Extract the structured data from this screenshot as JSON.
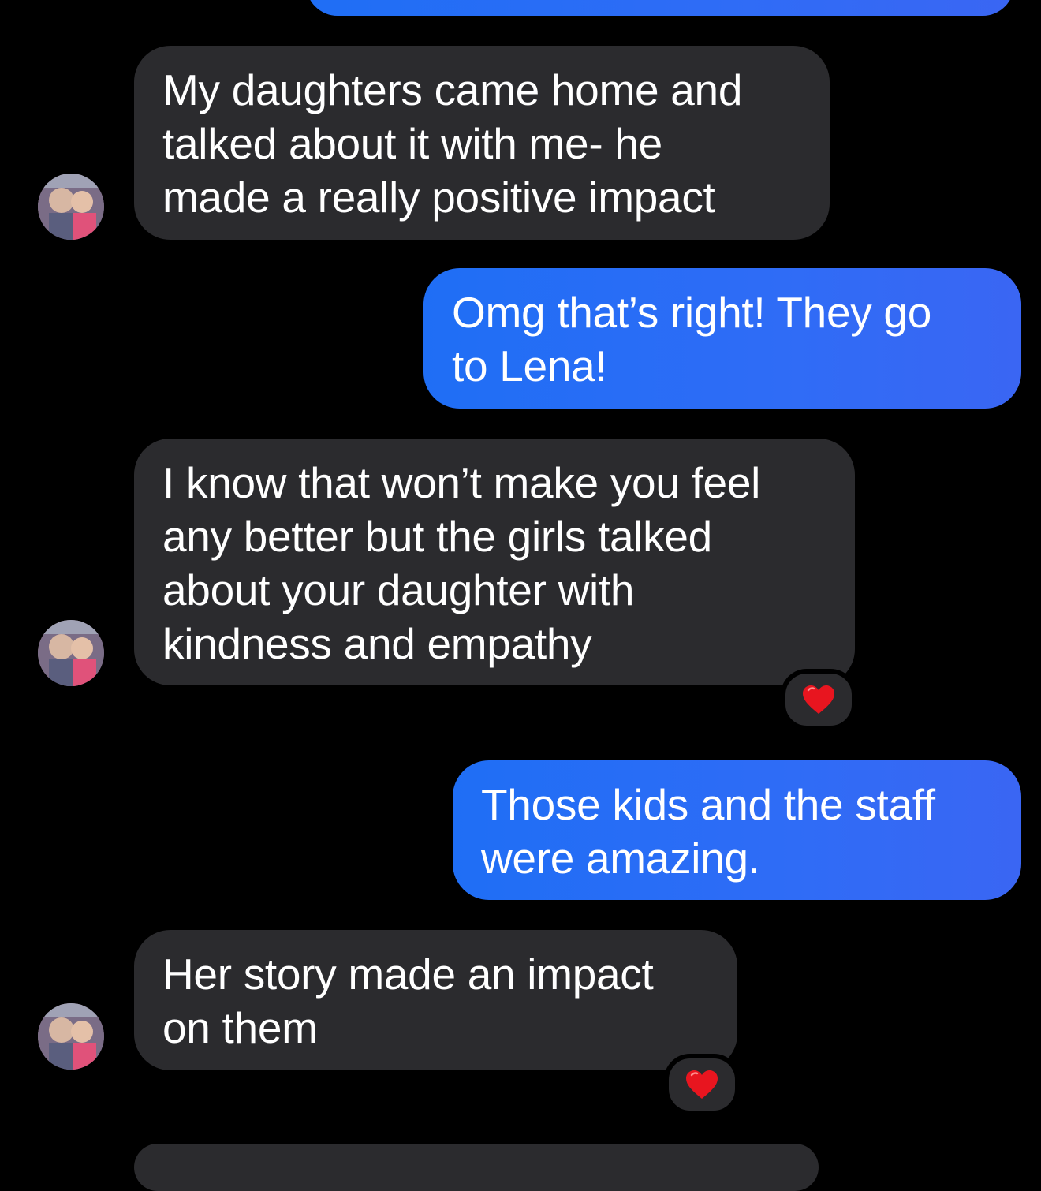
{
  "colors": {
    "background": "#000000",
    "incoming_bubble": "#2b2b2e",
    "outgoing_bubble": "#2f6cf6",
    "text": "#ffffff",
    "heart": "#e8151f"
  },
  "messages": [
    {
      "direction": "incoming",
      "text": "My daughters came home and\ntalked about it with me- he\nmade a really positive impact"
    },
    {
      "direction": "outgoing",
      "text": "Omg that’s right! They go\nto Lena!"
    },
    {
      "direction": "incoming",
      "text": "I know that won’t make you feel\nany better but the girls talked\nabout your daughter with\nkindness and empathy",
      "reaction": "heart-icon"
    },
    {
      "direction": "outgoing",
      "text": "Those kids and the staff\nwere amazing."
    },
    {
      "direction": "incoming",
      "text": "Her story made an impact\non them",
      "reaction": "heart-icon"
    }
  ]
}
